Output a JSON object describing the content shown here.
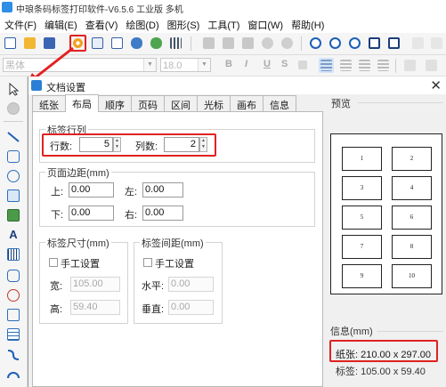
{
  "app": {
    "title": "中琅条码标签打印软件-V6.5.6 工业版 多机"
  },
  "menu": [
    "文件(F)",
    "编辑(E)",
    "查看(V)",
    "绘图(D)",
    "图形(S)",
    "工具(T)",
    "窗口(W)",
    "帮助(H)"
  ],
  "toolbar": {
    "icons": [
      "new-icon",
      "open-icon",
      "save-icon",
      "document-settings-icon",
      "print-icon",
      "print-preview-icon",
      "database-icon",
      "data-source-icon",
      "grid-icon",
      "cut-icon",
      "copy-icon",
      "paste-icon",
      "undo-icon",
      "redo-icon",
      "zoom-in-icon",
      "zoom-out-icon",
      "zoom-fit-icon",
      "zoom-page-icon",
      "zoom-100-icon"
    ]
  },
  "format": {
    "font_name": "黑体",
    "font_size": "18.0",
    "bold": "B",
    "italic": "I",
    "underline": "U",
    "strike": "S"
  },
  "dialog": {
    "title": "文档设置",
    "tabs": [
      "纸张",
      "布局",
      "顺序",
      "页码",
      "区间",
      "光标",
      "画布",
      "信息"
    ],
    "active_tab": "布局",
    "label_rows_cols": {
      "title": "标签行列",
      "rows_label": "行数:",
      "rows_value": "5",
      "cols_label": "列数:",
      "cols_value": "2"
    },
    "margins": {
      "title": "页面边距(mm)",
      "top_label": "上:",
      "top_value": "0.00",
      "left_label": "左:",
      "left_value": "0.00",
      "bottom_label": "下:",
      "bottom_value": "0.00",
      "right_label": "右:",
      "right_value": "0.00"
    },
    "label_size": {
      "title": "标签尺寸(mm)",
      "manual_label": "手工设置",
      "width_label": "宽:",
      "width_value": "105.00",
      "height_label": "高:",
      "height_value": "59.40"
    },
    "label_spacing": {
      "title": "标签间距(mm)",
      "manual_label": "手工设置",
      "horizontal_label": "水平:",
      "horizontal_value": "0.00",
      "vertical_label": "垂直:",
      "vertical_value": "0.00"
    },
    "preview": {
      "title": "预览",
      "cells": [
        "1",
        "2",
        "3",
        "4",
        "5",
        "6",
        "7",
        "8",
        "9",
        "10"
      ]
    },
    "info": {
      "title": "信息(mm)",
      "paper": "纸张: 210.00 x 297.00",
      "label": "标签: 105.00 x 59.40"
    }
  },
  "colors": {
    "highlight": "#e12121",
    "accent": "#2a7fd4",
    "dialog_bg": "#f0f0f0"
  }
}
